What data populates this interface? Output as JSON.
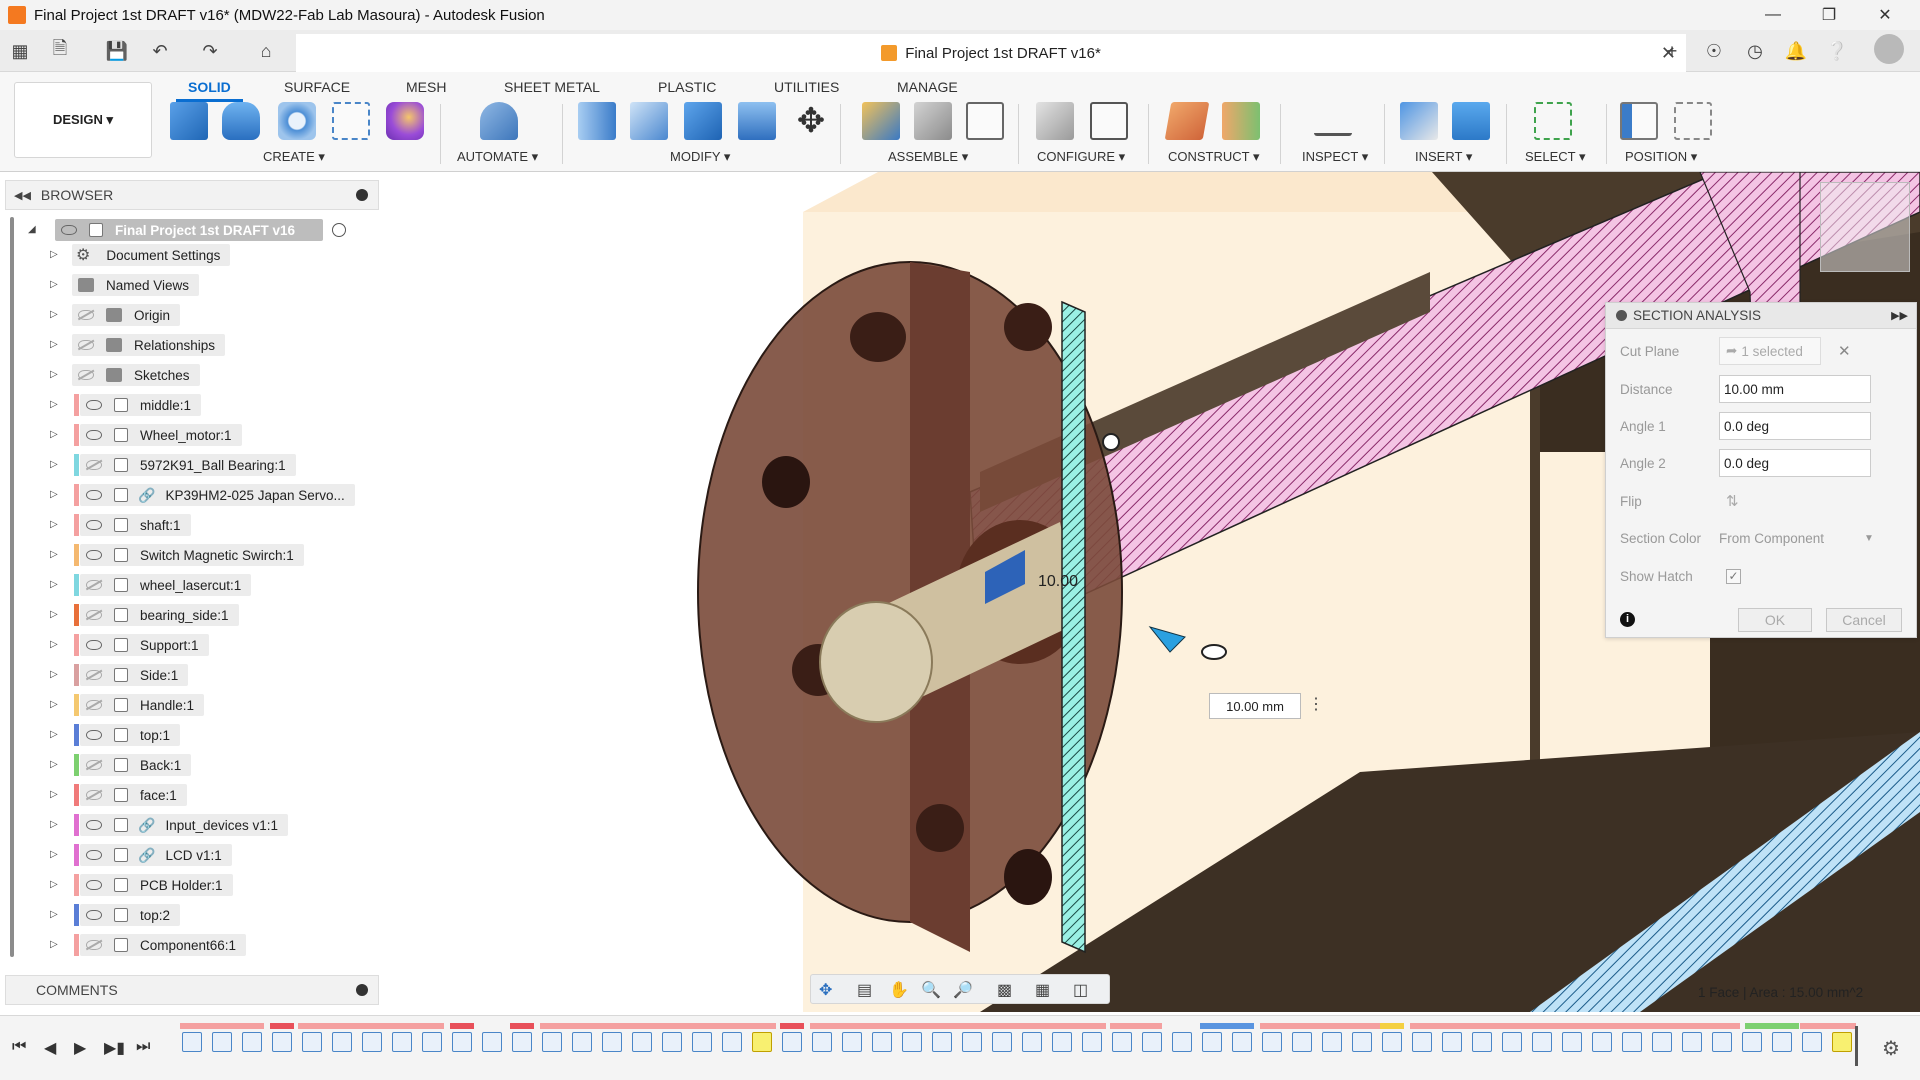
{
  "window": {
    "title": "Final Project 1st DRAFT v16* (MDW22-Fab Lab Masoura) - Autodesk Fusion",
    "controls": [
      "minimize",
      "restore",
      "close"
    ]
  },
  "document_tab": {
    "title": "Final Project 1st DRAFT v16*"
  },
  "workspace": {
    "label": "DESIGN ▾"
  },
  "ribbon": {
    "tabs": [
      "SOLID",
      "SURFACE",
      "MESH",
      "SHEET METAL",
      "PLASTIC",
      "UTILITIES",
      "MANAGE"
    ],
    "active_tab": "SOLID",
    "groups": [
      "CREATE ▾",
      "AUTOMATE ▾",
      "MODIFY ▾",
      "ASSEMBLE ▾",
      "CONFIGURE ▾",
      "CONSTRUCT ▾",
      "INSPECT ▾",
      "INSERT ▾",
      "SELECT ▾",
      "POSITION ▾"
    ]
  },
  "browser": {
    "title": "BROWSER",
    "root": "Final Project 1st DRAFT v16",
    "items": [
      {
        "label": "Document Settings",
        "kind": "settings"
      },
      {
        "label": "Named Views",
        "kind": "folder"
      },
      {
        "label": "Origin",
        "kind": "folder"
      },
      {
        "label": "Relationships",
        "kind": "folder"
      },
      {
        "label": "Sketches",
        "kind": "folder"
      },
      {
        "label": "middle:1",
        "kind": "component",
        "color": "#f4a0a0"
      },
      {
        "label": "Wheel_motor:1",
        "kind": "component",
        "color": "#f4a0a0"
      },
      {
        "label": "5972K91_Ball Bearing:1",
        "kind": "component",
        "color": "#7fd7e0"
      },
      {
        "label": "KP39HM2-025 Japan Servo...",
        "kind": "link",
        "color": "#f4a0a0"
      },
      {
        "label": "shaft:1",
        "kind": "component",
        "color": "#f4a0a0"
      },
      {
        "label": "Switch Magnetic Swirch:1",
        "kind": "component",
        "color": "#f4b870"
      },
      {
        "label": "wheel_lasercut:1",
        "kind": "component",
        "color": "#7fd7e0"
      },
      {
        "label": "bearing_side:1",
        "kind": "component",
        "color": "#e8703a"
      },
      {
        "label": "Support:1",
        "kind": "component",
        "color": "#f4a0a0"
      },
      {
        "label": "Side:1",
        "kind": "component",
        "color": "#d9a0a0"
      },
      {
        "label": "Handle:1",
        "kind": "component",
        "color": "#f4c870"
      },
      {
        "label": "top:1",
        "kind": "component",
        "color": "#5a7ed6"
      },
      {
        "label": "Back:1",
        "kind": "component",
        "color": "#7dd070"
      },
      {
        "label": "face:1",
        "kind": "component",
        "color": "#f07a7a"
      },
      {
        "label": "Input_devices v1:1",
        "kind": "link",
        "color": "#e070d0"
      },
      {
        "label": "LCD v1:1",
        "kind": "link",
        "color": "#e070d0"
      },
      {
        "label": "PCB Holder:1",
        "kind": "component",
        "color": "#f4a0a0"
      },
      {
        "label": "top:2",
        "kind": "component",
        "color": "#5a7ed6"
      },
      {
        "label": "Component66:1",
        "kind": "component",
        "color": "#f4a0a0"
      }
    ]
  },
  "comments": {
    "title": "COMMENTS"
  },
  "section_analysis": {
    "title": "SECTION ANALYSIS",
    "cut_plane_label": "Cut Plane",
    "cut_plane_value": "1 selected",
    "distance_label": "Distance",
    "distance_value": "10.00 mm",
    "angle1_label": "Angle 1",
    "angle1_value": "0.0 deg",
    "angle2_label": "Angle 2",
    "angle2_value": "0.0 deg",
    "flip_label": "Flip",
    "section_color_label": "Section Color",
    "section_color_value": "From Component",
    "show_hatch_label": "Show Hatch",
    "show_hatch_checked": true,
    "ok_label": "OK",
    "cancel_label": "Cancel"
  },
  "viewport": {
    "dimension_label": "10.00",
    "distance_box": "10.00 mm",
    "status": "1 Face | Area : 15.00 mm^2"
  },
  "colors": {
    "accent": "#0a6ed1",
    "wood_dark": "#6b4030",
    "hatch_pink": "#e9a9d4",
    "hatch_cyan": "#7fe0d4",
    "bg_cream": "#fdf1dd",
    "brown_back": "#4a3b2b"
  }
}
